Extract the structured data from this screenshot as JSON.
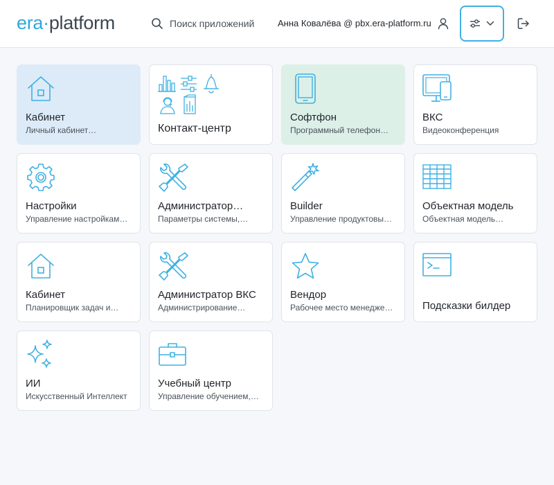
{
  "header": {
    "logo": {
      "part1": "era",
      "dot": "·",
      "part2": "platform"
    },
    "search_placeholder": "Поиск приложений",
    "user": "Анна Ковалёва @ pbx.era-platform.ru"
  },
  "colors": {
    "accent": "#3fb0e3",
    "card_blue": "#ddebf8",
    "card_green": "#dcf0e8"
  },
  "apps": [
    {
      "title": "Кабинет",
      "subtitle": "Личный кабинет…",
      "icon": "house-icon"
    },
    {
      "title": "Контакт-центр",
      "subtitle": "",
      "icon": "contact-center-icons"
    },
    {
      "title": "Софтфон",
      "subtitle": "Программный телефон…",
      "icon": "tablet-icon"
    },
    {
      "title": "ВКС",
      "subtitle": "Видеоконференция",
      "icon": "monitor-phone-icon"
    },
    {
      "title": "Настройки",
      "subtitle": "Управление настройкам…",
      "icon": "gear-icon"
    },
    {
      "title": "Администратор…",
      "subtitle": "Параметры системы,…",
      "icon": "tools-icon"
    },
    {
      "title": "Builder",
      "subtitle": "Управление продуктовы…",
      "icon": "magic-wand-icon"
    },
    {
      "title": "Объектная модель",
      "subtitle": "Объектная модель…",
      "icon": "table-grid-icon"
    },
    {
      "title": "Кабинет",
      "subtitle": "Планировщик задач и…",
      "icon": "house-icon"
    },
    {
      "title": "Администратор ВКС",
      "subtitle": "Администрирование…",
      "icon": "tools-icon"
    },
    {
      "title": "Вендор",
      "subtitle": "Рабочее место менедже…",
      "icon": "star-icon"
    },
    {
      "title": "Подсказки билдер",
      "subtitle": "",
      "icon": "terminal-icon"
    },
    {
      "title": "ИИ",
      "subtitle": "Искусственный Интеллект",
      "icon": "sparkles-icon"
    },
    {
      "title": "Учебный центр",
      "subtitle": "Управление обучением,…",
      "icon": "briefcase-icon"
    }
  ]
}
